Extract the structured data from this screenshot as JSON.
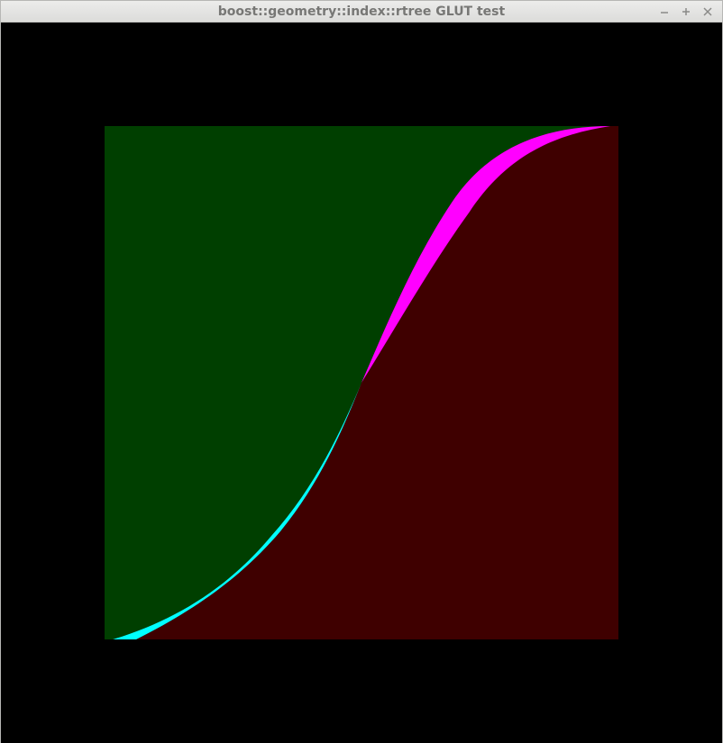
{
  "window": {
    "title": "boost::geometry::index::rtree GLUT test"
  },
  "window_controls": [
    {
      "name": "minimize",
      "icon": "minimize-icon"
    },
    {
      "name": "maximize",
      "icon": "maximize-icon"
    },
    {
      "name": "close",
      "icon": "close-icon"
    }
  ],
  "scene": {
    "background_color": "#000000",
    "regions": [
      {
        "name": "upper-left region",
        "color": "#003f00"
      },
      {
        "name": "lower-right region",
        "color": "#3f0000"
      },
      {
        "name": "lower sliver",
        "color": "#00ffff"
      },
      {
        "name": "upper sliver",
        "color": "#ff00ff"
      }
    ]
  }
}
